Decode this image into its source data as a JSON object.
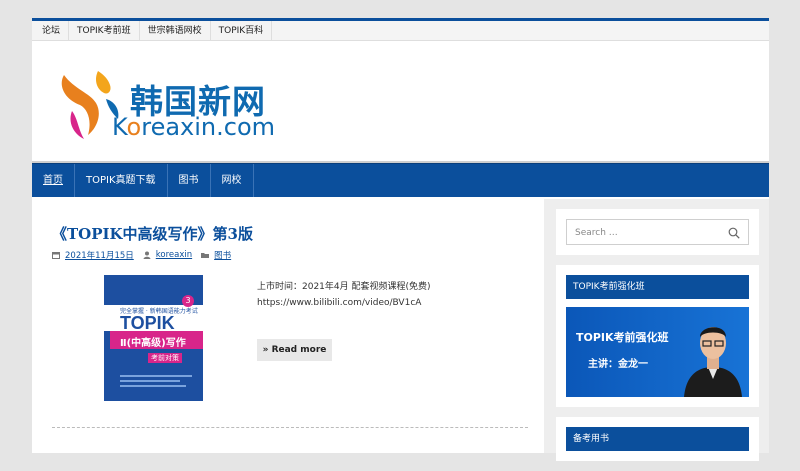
{
  "topnav": {
    "items": [
      "论坛",
      "TOPIK考前班",
      "世宗韩语网校",
      "TOPIK百科"
    ]
  },
  "header": {
    "logo_cn": "韩国新网",
    "logo_en_pre": "K",
    "logo_en_o": "o",
    "logo_en_rest": "reaxin.com"
  },
  "mainnav": {
    "items": [
      "首页",
      "TOPIK真题下载",
      "图书",
      "网校"
    ],
    "active": "首页"
  },
  "post": {
    "title": "《TOPIK中高级写作》第3版",
    "date": "2021年11月15日",
    "author": "koreaxin",
    "category": "图书",
    "excerpt": "上市时间：2021年4月 配套视频课程(免费) https://www.bilibili.com/video/BV1cA",
    "read_more": "» Read more",
    "cover": {
      "subtitle": "完全掌握 · 新韩国语能力考试",
      "title": "TOPIK",
      "level": "Ⅱ(中高级)写作",
      "tag": "考前对策",
      "edition": "3"
    }
  },
  "sidebar": {
    "search_placeholder": "Search …",
    "widget1_title": "TOPIK考前强化班",
    "banner_title": "TOPIK考前强化班",
    "banner_speaker": "主讲：金龙一",
    "widget2_title": "备考用书"
  },
  "colors": {
    "brand_blue": "#0b4f9c",
    "accent_orange": "#e8801e",
    "cover_pink": "#d8258a"
  }
}
